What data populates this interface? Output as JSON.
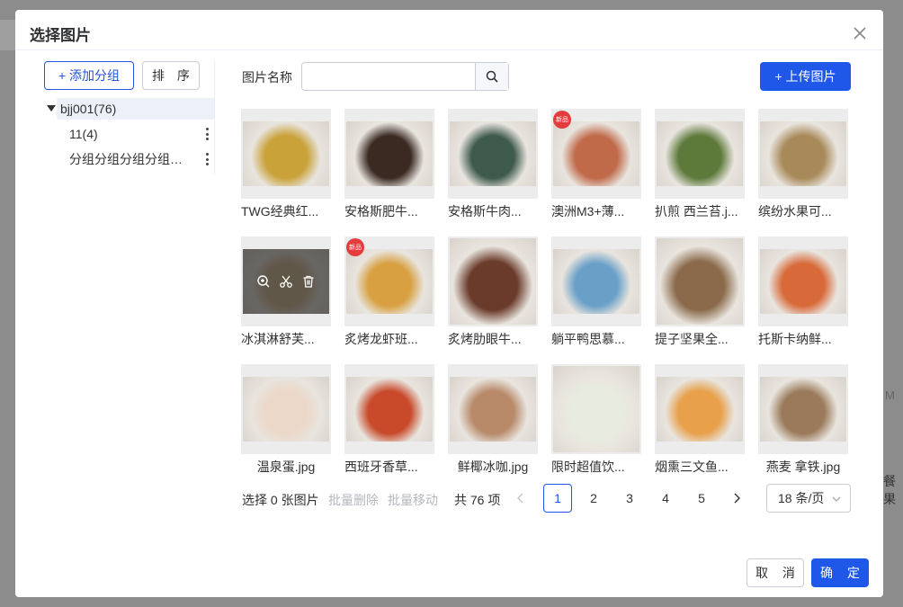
{
  "backdrop": {
    "frag_m": "M",
    "frag_guo": "餐果"
  },
  "dialog": {
    "title": "选择图片"
  },
  "left": {
    "add_group": "+ 添加分组",
    "sort": "排 序",
    "tree": {
      "root": "bjj001(76)",
      "children": [
        "11(4)",
        "分组分组分组分组分组"
      ]
    }
  },
  "toolbar": {
    "name_label": "图片名称",
    "search_value": "",
    "upload": "+ 上传图片"
  },
  "images": [
    {
      "caption": "TWG经典红...",
      "color": "#c9a23a"
    },
    {
      "caption": "安格斯肥牛...",
      "color": "#3a2a22"
    },
    {
      "caption": "安格斯牛肉...",
      "color": "#3d5a4a"
    },
    {
      "caption": "澳洲M3+薄...",
      "color": "#c06a4a"
    },
    {
      "caption": "扒煎 西兰苔.j...",
      "color": "#5d7a3a"
    },
    {
      "caption": "缤纷水果可...",
      "color": "#a88a5a"
    },
    {
      "caption": "冰淇淋舒芙...",
      "color": "#d8c0a0"
    },
    {
      "caption": "炙烤龙虾班...",
      "color": "#d8a040"
    },
    {
      "caption": "炙烤肋眼牛...",
      "color": "#6a3a2a"
    },
    {
      "caption": "躺平鸭思慕...",
      "color": "#6aa0c8"
    },
    {
      "caption": "提子坚果全...",
      "color": "#8a6a4a"
    },
    {
      "caption": "托斯卡纳鲜...",
      "color": "#d86a3a"
    },
    {
      "caption": "温泉蛋.jpg",
      "color": "#ecd8c8"
    },
    {
      "caption": "西班牙香草...",
      "color": "#c84a2a"
    },
    {
      "caption": "鲜椰冰咖.jpg",
      "color": "#b88a6a"
    },
    {
      "caption": "限时超值饮...",
      "color": "#e8ece0"
    },
    {
      "caption": "烟熏三文鱼...",
      "color": "#e8a04a"
    },
    {
      "caption": "燕麦 拿铁.jpg",
      "color": "#9a7a5a"
    }
  ],
  "badge_text": "新品",
  "footer": {
    "selected": "选择 0 张图片",
    "batch_delete": "批量删除",
    "batch_move": "批量移动",
    "total": "共 76 项",
    "pages": [
      "1",
      "2",
      "3",
      "4",
      "5"
    ],
    "current_page": "1",
    "page_size": "18 条/页"
  },
  "actions": {
    "cancel": "取 消",
    "confirm": "确 定"
  },
  "colors": {
    "primary": "#1f58e8",
    "overlay": "rgba(0,0,0,0.55)"
  }
}
